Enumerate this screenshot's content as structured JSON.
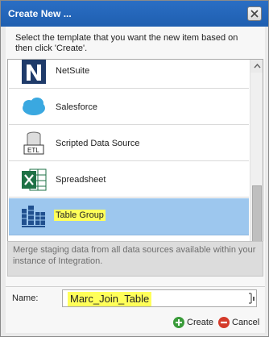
{
  "dialog": {
    "title": "Create New ...",
    "instructions": "Select the template that you want the new item based on then click 'Create'.",
    "templates": [
      {
        "label": "NetSuite",
        "icon": "netsuite-icon",
        "selected": false
      },
      {
        "label": "Salesforce",
        "icon": "salesforce-icon",
        "selected": false
      },
      {
        "label": "Scripted Data Source",
        "icon": "etl-icon",
        "selected": false
      },
      {
        "label": "Spreadsheet",
        "icon": "spreadsheet-icon",
        "selected": false
      },
      {
        "label": "Table Group",
        "icon": "table-group-icon",
        "selected": true
      }
    ],
    "description": "Merge staging data from all data sources available within your instance of Integration.",
    "name_label": "Name:",
    "name_value": "Marc_Join_Table",
    "create_label": "Create",
    "cancel_label": "Cancel",
    "colors": {
      "titlebar": "#1f5fb0",
      "selection": "#9dc7ee",
      "highlight": "#ffff5a"
    }
  }
}
